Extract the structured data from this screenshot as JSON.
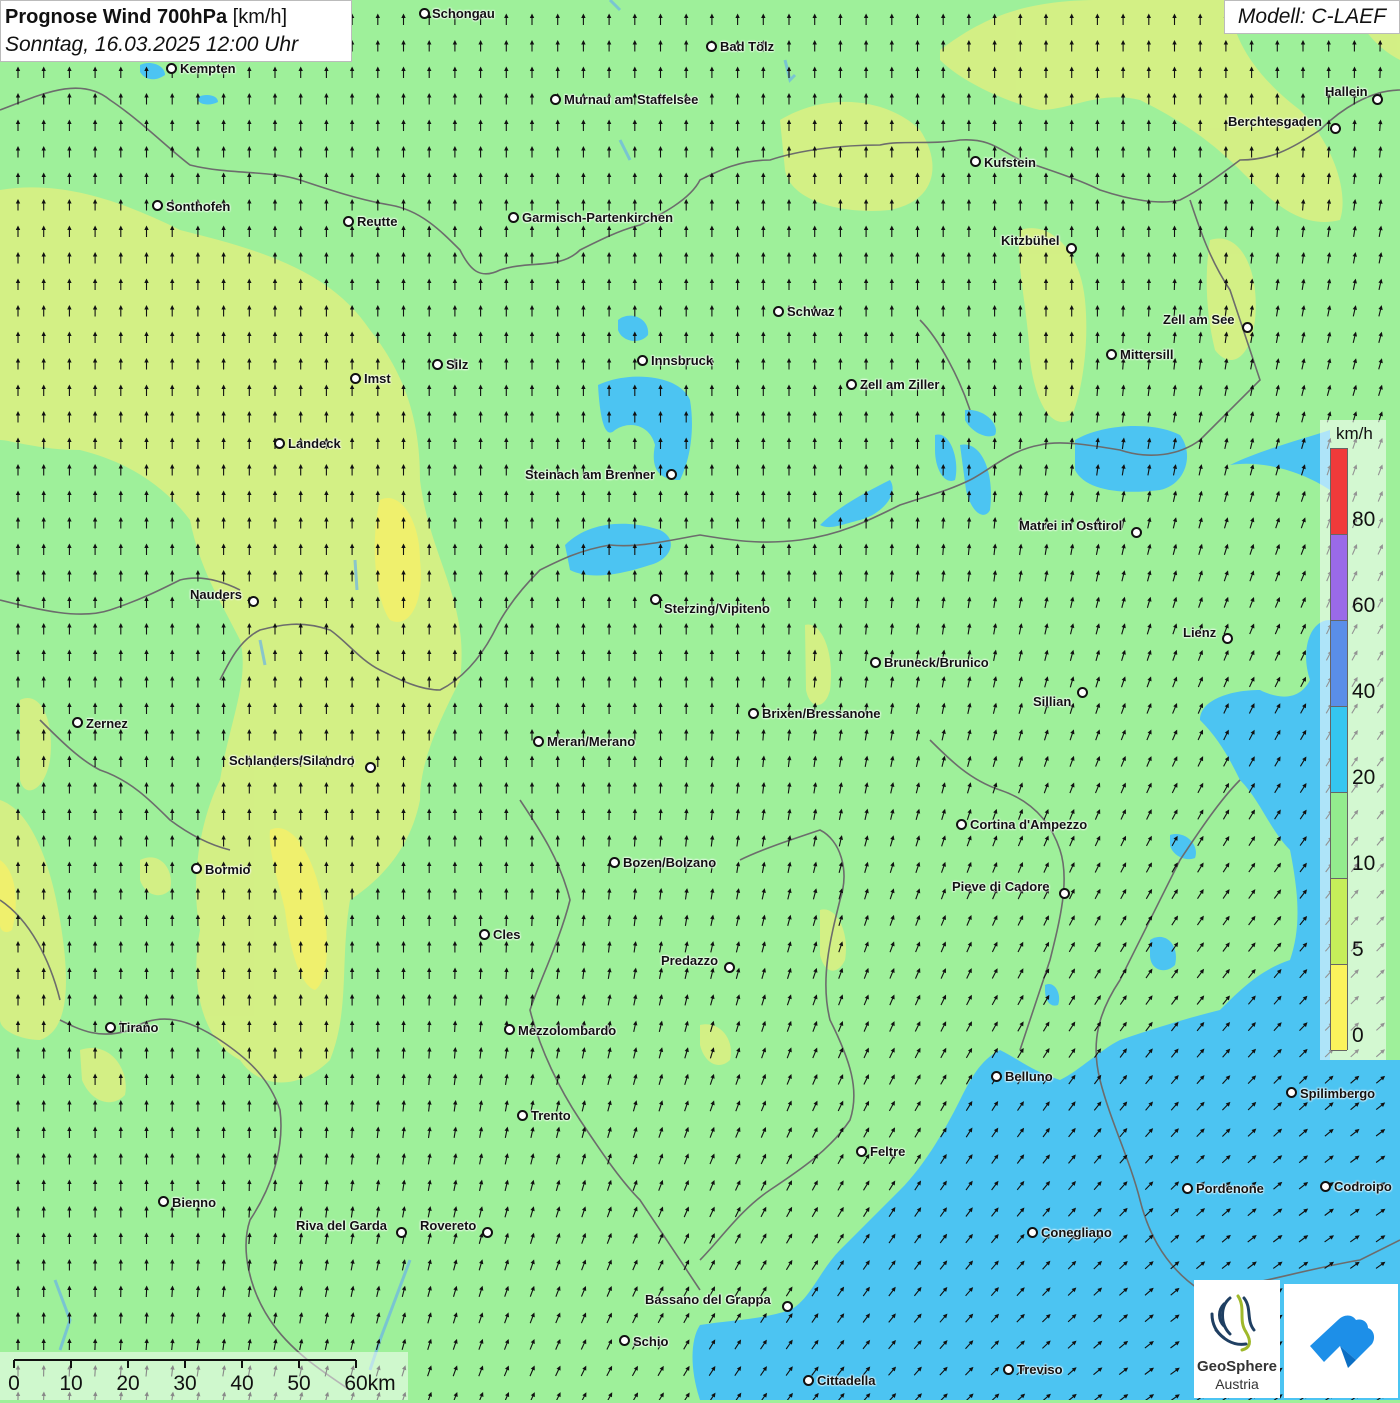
{
  "header": {
    "title_bold": "Prognose Wind 700hPa",
    "title_unit": "[km/h]",
    "datetime": "Sonntag, 16.03.2025 12:00 Uhr",
    "model": "Modell: C-LAEF"
  },
  "legend": {
    "unit": "km/h",
    "labels": [
      "80",
      "60",
      "40",
      "20",
      "10",
      "5",
      "0"
    ],
    "colors": [
      "#f03a3a",
      "#9a6ae8",
      "#5a8ee8",
      "#35c6f0",
      "#93ec8e",
      "#c6ee5a",
      "#fbf35c"
    ]
  },
  "scale_bar": {
    "labels": [
      "0",
      "10",
      "20",
      "30",
      "40",
      "50",
      "60km"
    ]
  },
  "colors": {
    "background_wind": "#9ef09a",
    "low_wind": "#d9f082",
    "very_low_wind": "#f5ef66",
    "strong_wind": "#4cc4f2",
    "borders": "#6c6c6c"
  },
  "cities": [
    {
      "name": "Schongau"
    },
    {
      "name": "Kempten"
    },
    {
      "name": "Bad Tölz"
    },
    {
      "name": "Murnau am Staffelsee"
    },
    {
      "name": "Hallein"
    },
    {
      "name": "Berchtesgaden"
    },
    {
      "name": "Kufstein"
    },
    {
      "name": "Sonthofen"
    },
    {
      "name": "Reutte"
    },
    {
      "name": "Garmisch-Partenkirchen"
    },
    {
      "name": "Kitzbühel"
    },
    {
      "name": "Schwaz"
    },
    {
      "name": "Zell am See"
    },
    {
      "name": "Silz"
    },
    {
      "name": "Innsbruck"
    },
    {
      "name": "Mittersill"
    },
    {
      "name": "Imst"
    },
    {
      "name": "Zell am Ziller"
    },
    {
      "name": "Landeck"
    },
    {
      "name": "Steinach am Brenner"
    },
    {
      "name": "Matrei in Osttirol"
    },
    {
      "name": "Nauders"
    },
    {
      "name": "Sterzing/Vipiteno"
    },
    {
      "name": "Lienz"
    },
    {
      "name": "Bruneck/Brunico"
    },
    {
      "name": "Sillian"
    },
    {
      "name": "Brixen/Bressanone"
    },
    {
      "name": "Zernez"
    },
    {
      "name": "Meran/Merano"
    },
    {
      "name": "Schlanders/Silandro"
    },
    {
      "name": "Cortina d'Ampezzo"
    },
    {
      "name": "Bozen/Bolzano"
    },
    {
      "name": "Bormio"
    },
    {
      "name": "Pieve di Cadore"
    },
    {
      "name": "Cles"
    },
    {
      "name": "Predazzo"
    },
    {
      "name": "Tirano"
    },
    {
      "name": "Mezzolombardo"
    },
    {
      "name": "Belluno"
    },
    {
      "name": "Spilimbergo"
    },
    {
      "name": "Trento"
    },
    {
      "name": "Feltre"
    },
    {
      "name": "Pordenone"
    },
    {
      "name": "Codroipo"
    },
    {
      "name": "Bienno"
    },
    {
      "name": "Riva del Garda"
    },
    {
      "name": "Rovereto"
    },
    {
      "name": "Conegliano"
    },
    {
      "name": "Bassano del Grappa"
    },
    {
      "name": "Schio"
    },
    {
      "name": "Treviso"
    },
    {
      "name": "Cittadella"
    }
  ],
  "logos": {
    "geosphere_line1": "GeoSphere",
    "geosphere_line2": "Austria"
  },
  "icons": {
    "wind_arrow": "wind-arrow-icon",
    "geosphere_logo": "geosphere-logo-icon",
    "cloud_logo": "cloud-logo-icon"
  }
}
